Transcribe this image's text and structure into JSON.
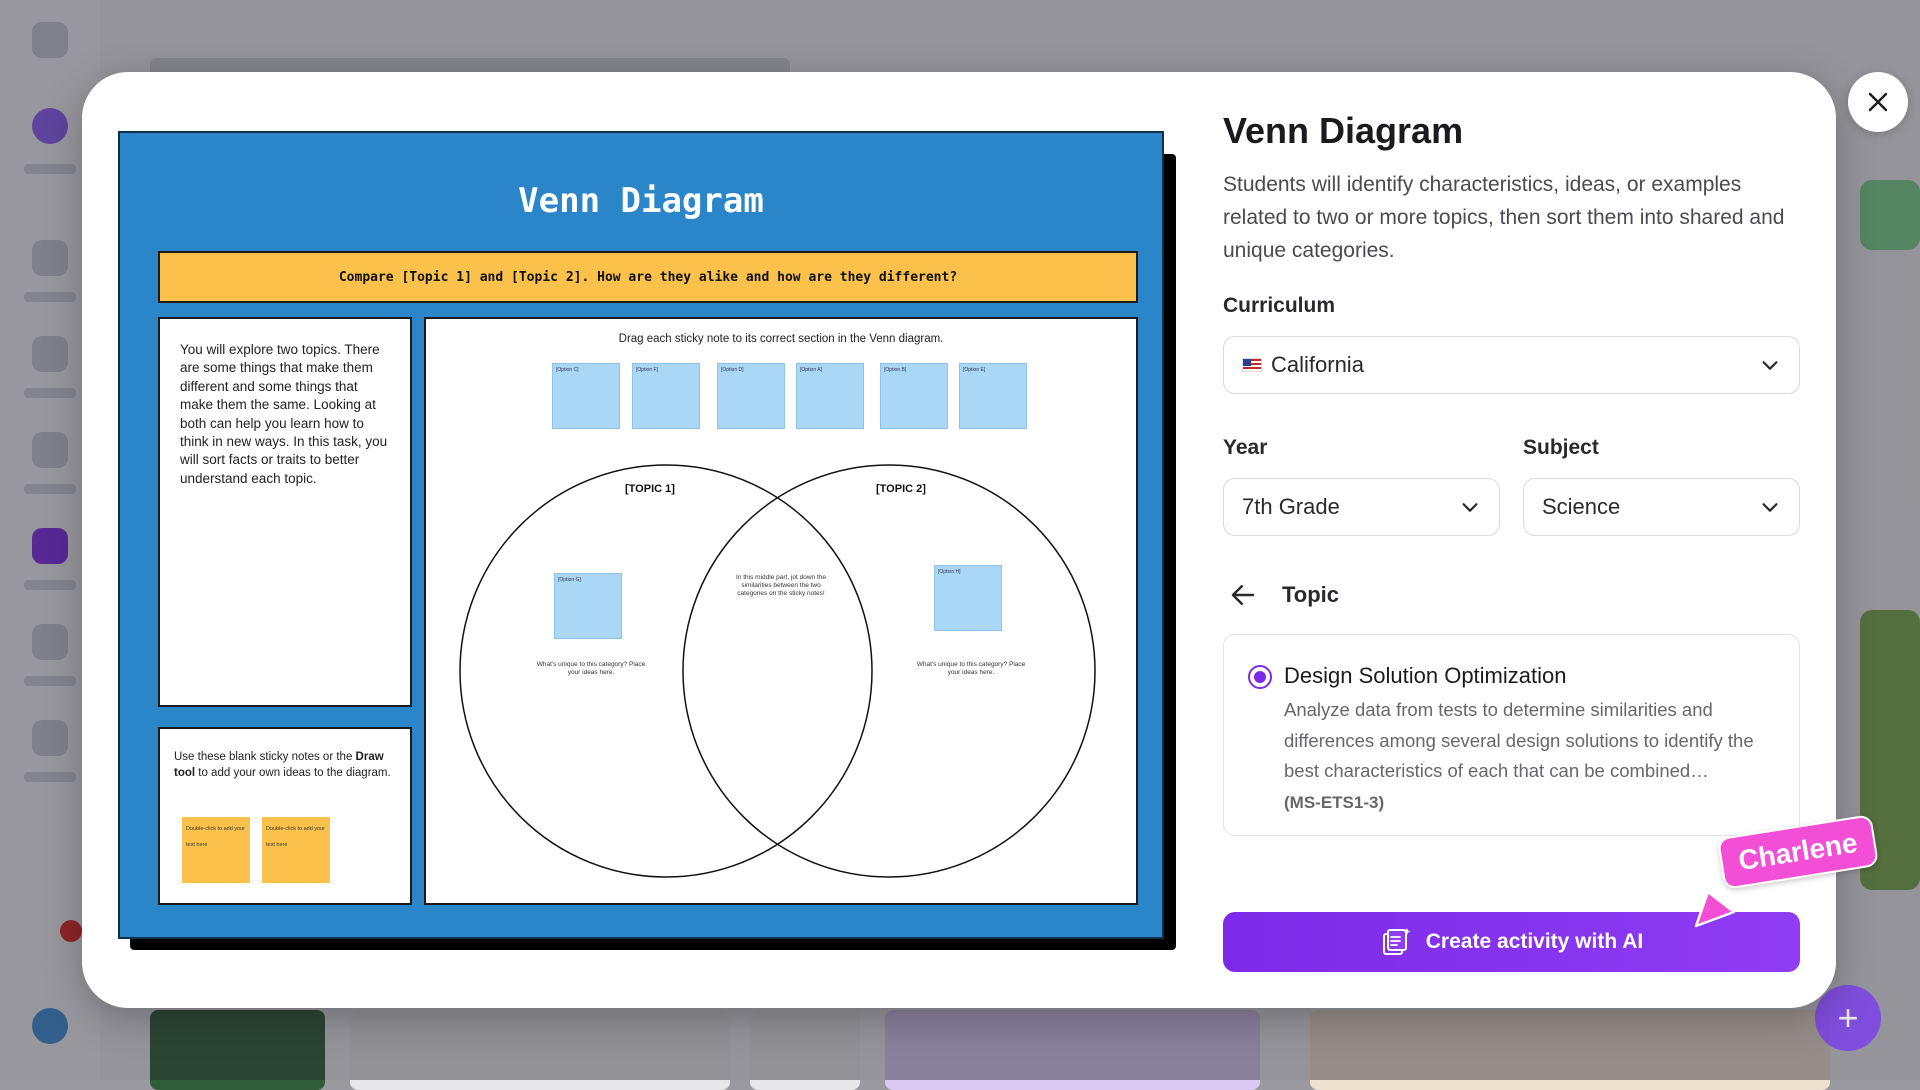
{
  "preview": {
    "title": "Venn Diagram",
    "banner": "Compare [Topic 1] and [Topic 2]. How are they alike and how are they different?",
    "intro": "You will explore two topics. There are some things that make them different and some things that make them the same. Looking at both can help you learn how to think in new ways. In this task, you will sort facts or traits to better understand each topic.",
    "blank_pre": "Use these blank sticky notes or the ",
    "blank_bold": "Draw tool",
    "blank_post": " to add your own ideas to the diagram.",
    "blank_stickies": [
      "Double-click to add your text here",
      "Double-click to add your text here"
    ],
    "instruction": "Drag each sticky note to its correct section in the Venn diagram.",
    "options": [
      "[Option C]",
      "[Option F]",
      "[Option D]",
      "[Option A]",
      "[Option B]",
      "[Option E]"
    ],
    "topic1": "[TOPIC 1]",
    "topic2": "[TOPIC 2]",
    "left_sticky": "[Option G]",
    "right_sticky": "[Option H]",
    "middle_note": "In this middle part, jot down the similarities between the two categories on the sticky notes!",
    "left_note": "What's unique to this category? Place your ideas here.",
    "right_note": "What's unique to this category? Place your ideas here."
  },
  "panel": {
    "title": "Venn Diagram",
    "description": "Students will identify characteristics, ideas, or examples related to two or more topics, then sort them into shared and unique categories.",
    "curriculum_label": "Curriculum",
    "curriculum_value": "California",
    "year_label": "Year",
    "year_value": "7th Grade",
    "subject_label": "Subject",
    "subject_value": "Science",
    "topic_label": "Topic",
    "topic_name": "Design Solution Optimization",
    "topic_desc": "Analyze data from tests to determine similarities and differences among several design solutions to identify the best characteristics of each that can be combined…",
    "topic_code": "(MS-ETS1-3)",
    "cta": "Create activity with AI",
    "collaborator": "Charlene"
  },
  "colors": {
    "accent": "#7d2ae8",
    "preview_bg": "#2a86c9",
    "banner": "#fcc14a",
    "sticky_blue": "#a9d7f5",
    "collaborator_tag": "#f24fd6"
  }
}
